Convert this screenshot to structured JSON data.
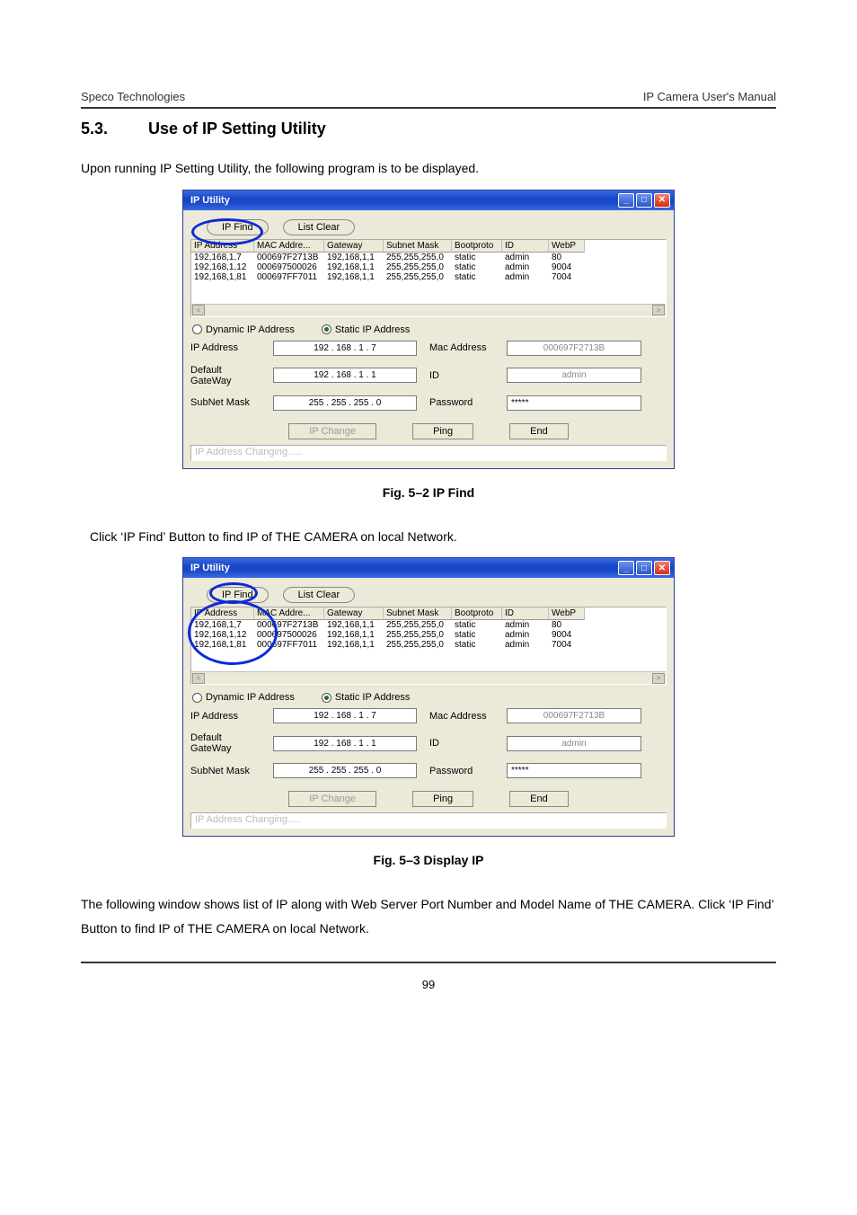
{
  "header": {
    "company": "Speco Technologies",
    "doc": "IP Camera User's Manual"
  },
  "section": {
    "number": "5.3.",
    "title": "Use of IP Setting Utility"
  },
  "para1": "Upon running IP Setting Utility, the following program is to be displayed.",
  "caption1": "Fig. 5–2 IP Find",
  "para2": "Click ‘IP Find’ Button to find IP of THE CAMERA on local Network.",
  "caption2": "Fig.  5–3 Display IP",
  "para3": "The following window shows list of IP along with Web Server Port Number and Model Name of THE CAMERA. Click ‘IP Find’ Button to find IP of THE CAMERA on local Network.",
  "pageNumber": "99",
  "win": {
    "title": "IP Utility",
    "btnIpFind": "IP Find",
    "btnListClear": "List Clear",
    "cols": {
      "c0": "IP Address",
      "c1": "MAC Addre...",
      "c2": "Gateway",
      "c3": "Subnet Mask",
      "c4": "Bootproto",
      "c5": "ID",
      "c6": "WebP"
    },
    "rows": [
      {
        "c0": "192,168,1,7",
        "c1": "000697F2713B",
        "c2": "192,168,1,1",
        "c3": "255,255,255,0",
        "c4": "static",
        "c5": "admin",
        "c6": "80"
      },
      {
        "c0": "192,168,1,12",
        "c1": "000697500026",
        "c2": "192,168,1,1",
        "c3": "255,255,255,0",
        "c4": "static",
        "c5": "admin",
        "c6": "9004"
      },
      {
        "c0": "192,168,1,81",
        "c1": "000697FF7011",
        "c2": "192,168,1,1",
        "c3": "255,255,255,0",
        "c4": "static",
        "c5": "admin",
        "c6": "7004"
      }
    ],
    "radioDynamic": "Dynamic IP Address",
    "radioStatic": "Static IP Address",
    "lblIp": "IP Address",
    "lblGw": "Default GateWay",
    "lblSn": "SubNet Mask",
    "lblMac": "Mac Address",
    "lblId": "ID",
    "lblPw": "Password",
    "valIp": "192 . 168 .  1  .  7",
    "valGw": "192 . 168 .  1  .  1",
    "valSn": "255 . 255 . 255 .  0",
    "valMac": "000697F2713B",
    "valId": "admin",
    "valPw": "*****",
    "btnChange": "IP Change",
    "btnPing": "Ping",
    "btnEnd": "End",
    "status": "IP Address Changing....."
  }
}
